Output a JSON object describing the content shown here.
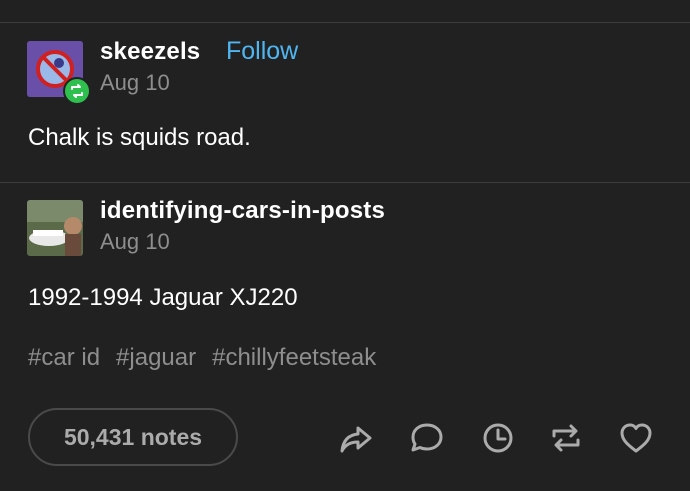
{
  "post1": {
    "username": "skeezels",
    "follow_label": "Follow",
    "date": "Aug 10",
    "text": "Chalk is squids road."
  },
  "post2": {
    "username": "identifying-cars-in-posts",
    "date": "Aug 10",
    "text": "1992-1994 Jaguar XJ220",
    "tags": [
      "#car id",
      "#jaguar",
      "#chillyfeetsteak"
    ]
  },
  "footer": {
    "notes": "50,431 notes"
  },
  "icons": {
    "share": "share-icon",
    "reply": "reply-icon",
    "history": "clock-icon",
    "reblog": "reblog-icon",
    "like": "heart-icon"
  },
  "colors": {
    "background": "#212121",
    "follow": "#4fb6f2",
    "reblog_badge": "#2fbf4f",
    "muted": "#8e8e8e"
  }
}
